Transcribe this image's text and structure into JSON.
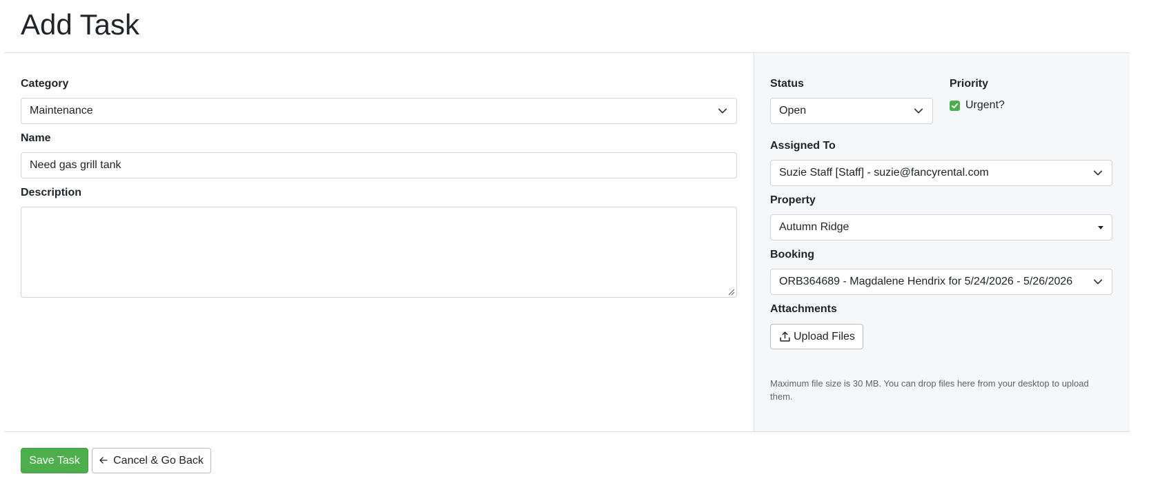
{
  "page": {
    "title": "Add Task"
  },
  "form": {
    "category": {
      "label": "Category",
      "value": "Maintenance"
    },
    "name": {
      "label": "Name",
      "value": "Need gas grill tank"
    },
    "description": {
      "label": "Description",
      "value": ""
    }
  },
  "sidebar": {
    "status": {
      "label": "Status",
      "value": "Open"
    },
    "priority": {
      "label": "Priority",
      "checkbox_label": "Urgent?",
      "checked": true
    },
    "assigned_to": {
      "label": "Assigned To",
      "value": "Suzie Staff [Staff] - suzie@fancyrental.com"
    },
    "property": {
      "label": "Property",
      "value": "Autumn Ridge"
    },
    "booking": {
      "label": "Booking",
      "value": "ORB364689 - Magdalene Hendrix for 5/24/2026 - 5/26/2026"
    },
    "attachments": {
      "label": "Attachments",
      "upload_label": "Upload Files",
      "help": "Maximum file size is 30 MB. You can drop files here from your desktop to upload them."
    }
  },
  "actions": {
    "save_label": "Save Task",
    "cancel_label": "Cancel & Go Back"
  },
  "colors": {
    "success": "#4cae4c",
    "sidebar_bg": "#f6f7f8",
    "border": "#ced4da"
  }
}
